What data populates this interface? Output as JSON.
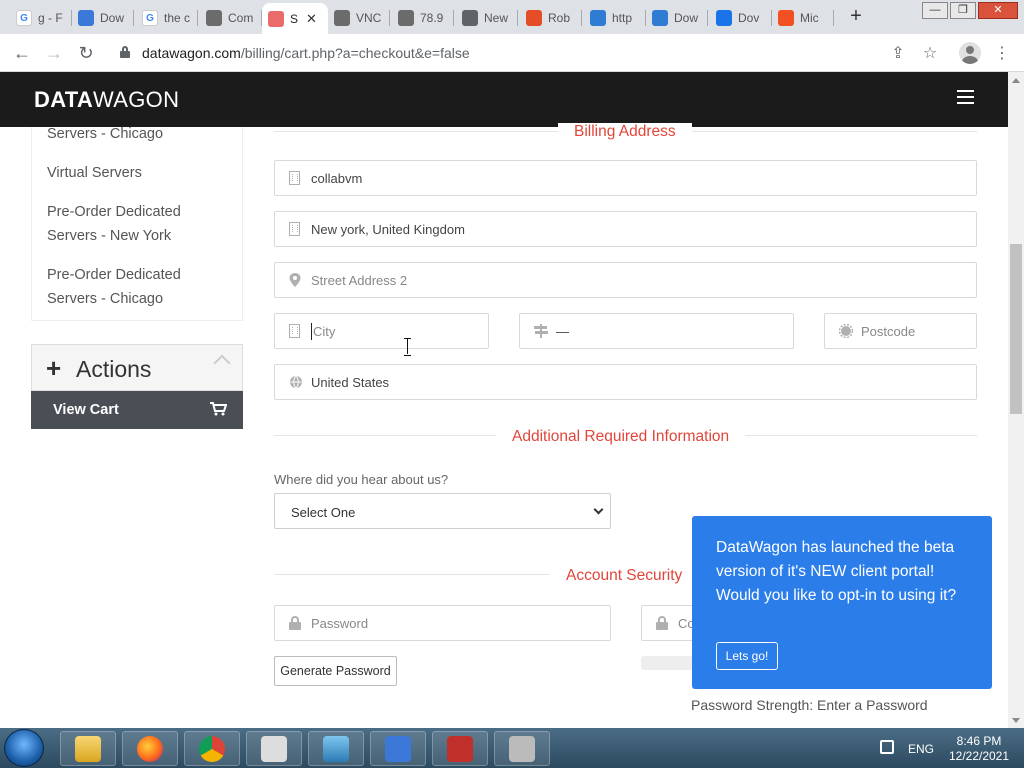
{
  "browser": {
    "tabs": [
      {
        "title": "g - F",
        "favicon": "google-icon",
        "color": "#ffffff"
      },
      {
        "title": "Dow",
        "favicon": "vs-code-icon",
        "color": "#3c78d8"
      },
      {
        "title": "the c",
        "favicon": "google-icon",
        "color": "#ffffff"
      },
      {
        "title": "Com",
        "favicon": "collabvm-icon",
        "color": "#6b6b6b"
      },
      {
        "title": "S",
        "favicon": "datawagon-icon",
        "color": "#e96b6b",
        "active": true
      },
      {
        "title": "VNC",
        "favicon": "collabvm-icon",
        "color": "#6b6b6b"
      },
      {
        "title": "78.9",
        "favicon": "collabvm-icon",
        "color": "#6b6b6b"
      },
      {
        "title": "New",
        "favicon": "chrome-icon",
        "color": "#5f6368"
      },
      {
        "title": "Rob",
        "favicon": "roblox-icon",
        "color": "#e44d26"
      },
      {
        "title": "http",
        "favicon": "ie-icon",
        "color": "#2f7cd3"
      },
      {
        "title": "Dow",
        "favicon": "download-icon",
        "color": "#2f7cd3"
      },
      {
        "title": "Dov",
        "favicon": "check-icon",
        "color": "#1a73e8"
      },
      {
        "title": "Mic",
        "favicon": "microsoft-icon",
        "color": "#f25022"
      }
    ],
    "url_host": "datawagon.com",
    "url_path": "/billing/cart.php?a=checkout&e=false"
  },
  "site": {
    "logo_bold": "DATA",
    "logo_thin": "WAGON"
  },
  "sidebar": {
    "items": [
      {
        "label": "Servers - Chicago"
      },
      {
        "label": "Virtual Servers"
      },
      {
        "label": "Pre-Order Dedicated Servers - New York"
      },
      {
        "label": "Pre-Order Dedicated Servers - Chicago"
      }
    ],
    "actions_title": "Actions",
    "view_cart_label": "View Cart"
  },
  "billing": {
    "section_title": "Billing Address",
    "company": "collabvm",
    "address1": "New york, United Kingdom",
    "address2_placeholder": "Street Address 2",
    "city_placeholder": "City",
    "state_value": "—",
    "postcode_placeholder": "Postcode",
    "country": "United States"
  },
  "additional": {
    "section_title": "Additional Required Information",
    "question_label": "Where did you hear about us?",
    "select_value": "Select One"
  },
  "security": {
    "section_title": "Account Security",
    "password_placeholder": "Password",
    "confirm_placeholder": "Co",
    "generate_label": "Generate Password",
    "strength_text": "Password Strength: Enter a Password"
  },
  "popup": {
    "message": "DataWagon has launched the beta version of it's NEW client portal! Would you like to opt-in to using it?",
    "button_label": "Lets go!",
    "close_glyph": "×"
  },
  "taskbar": {
    "language": "ENG",
    "time": "8:46 PM",
    "date": "12/22/2021"
  }
}
